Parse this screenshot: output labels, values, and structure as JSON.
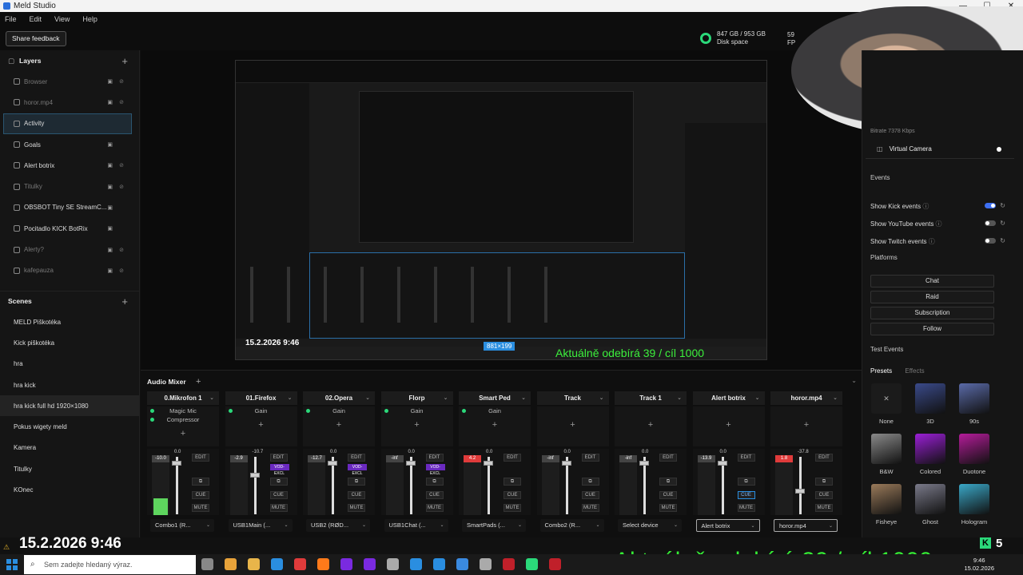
{
  "window": {
    "title": "Meld Studio",
    "controls": [
      "—",
      "☐",
      "✕"
    ]
  },
  "menu": [
    "File",
    "Edit",
    "View",
    "Help"
  ],
  "toolbar": {
    "share_feedback": "Share feedback",
    "disk_usage": "847 GB / 953 GB",
    "disk_label": "Disk space",
    "fps_value": "59",
    "fps_label": "FP"
  },
  "layers": {
    "title": "Layers",
    "items": [
      {
        "label": "Browser",
        "dim": true,
        "locked": true,
        "hidden": true
      },
      {
        "label": "horor.mp4",
        "dim": true,
        "locked": true,
        "hidden": true
      },
      {
        "label": "Activity",
        "active": true
      },
      {
        "label": "Goals",
        "locked": true
      },
      {
        "label": "Alert botrix",
        "locked": true,
        "hidden": true
      },
      {
        "label": "Titulky",
        "dim": true,
        "locked": true,
        "hidden": true
      },
      {
        "label": "OBSBOT Tiny SE StreamC...",
        "locked": true
      },
      {
        "label": "Pocitadlo KICK BotRix",
        "locked": true
      },
      {
        "label": "Alerty?",
        "dim": true,
        "locked": true,
        "hidden": true
      },
      {
        "label": "kafepauza",
        "dim": true,
        "locked": true,
        "hidden": true
      }
    ]
  },
  "scenes": {
    "title": "Scenes",
    "items": [
      "MELD Piškotéka",
      "Kick piškotéka",
      "hra",
      "hra kick",
      "hra kick full hd 1920×1080",
      "Pokus wigety meld",
      "Kamera",
      "Titulky",
      "KOnec"
    ],
    "selected_index": 4
  },
  "preview": {
    "date_overlay": "15.2.2026 9:46",
    "subtitle_overlay": "Aktuálně odebírá 39 / cíl 1000",
    "selection_size": "881×199"
  },
  "right_panel": {
    "bitrate": "Bitrate  7378 Kbps",
    "virtual_camera": "Virtual Camera",
    "events_title": "Events",
    "events": [
      {
        "label": "Show Kick events",
        "on": true
      },
      {
        "label": "Show YouTube events",
        "on": false
      },
      {
        "label": "Show Twitch events",
        "on": false
      }
    ],
    "platforms_title": "Platforms",
    "platform_buttons": [
      "Chat",
      "Raid",
      "Subscription",
      "Follow"
    ],
    "test_events_title": "Test Events",
    "tabs": [
      "Presets",
      "Effects"
    ],
    "presets": [
      {
        "label": "None",
        "color": "#1b1b1b"
      },
      {
        "label": "3D",
        "color": "#3a4a8a"
      },
      {
        "label": "90s",
        "color": "#5a6aa8"
      },
      {
        "label": "B&W",
        "color": "#8a8a8a"
      },
      {
        "label": "Colored",
        "color": "#9b1fd6"
      },
      {
        "label": "Duotone",
        "color": "#b51c9a"
      },
      {
        "label": "Fisheye",
        "color": "#9a7a5a"
      },
      {
        "label": "Ghost",
        "color": "#7a7a8a"
      },
      {
        "label": "Hologram",
        "color": "#3aa8c8"
      }
    ]
  },
  "mixer": {
    "title": "Audio Mixer",
    "channels": [
      {
        "name": "0.Mikrofon 1",
        "fx": [
          "Magic Mic",
          "Compressor"
        ],
        "level": "-10.0",
        "peak": "0.0",
        "meter_fill": 0.28,
        "fader": 0.08,
        "vod": false,
        "cue_on": false,
        "device": "Combo1 (R...",
        "highlight": false,
        "red": false
      },
      {
        "name": "01.Firefox",
        "fx": [
          "Gain"
        ],
        "level": "-2.9",
        "peak": "-10.7",
        "meter_fill": 0.0,
        "fader": 0.3,
        "vod": true,
        "cue_on": false,
        "device": "USB1Main (...",
        "highlight": false,
        "red": false
      },
      {
        "name": "02.Opera",
        "fx": [
          "Gain"
        ],
        "level": "-12.7",
        "peak": "0.0",
        "meter_fill": 0.0,
        "fader": 0.08,
        "vod": true,
        "cue_on": false,
        "device": "USB2 (RØD...",
        "highlight": false,
        "red": false
      },
      {
        "name": "Florp",
        "fx": [
          "Gain"
        ],
        "level": "-inf",
        "peak": "0.0",
        "meter_fill": 0.0,
        "fader": 0.08,
        "vod": true,
        "cue_on": false,
        "device": "USB1Chat (...",
        "highlight": false,
        "red": false
      },
      {
        "name": "Smart Ped",
        "fx": [
          "Gain"
        ],
        "level": "4.2",
        "peak": "0.0",
        "meter_fill": 0.0,
        "fader": 0.08,
        "vod": false,
        "cue_on": false,
        "device": "SmartPads (...",
        "highlight": false,
        "red": true
      },
      {
        "name": "Track",
        "fx": [],
        "level": "-inf",
        "peak": "0.0",
        "meter_fill": 0.0,
        "fader": 0.08,
        "vod": false,
        "cue_on": false,
        "device": "Combo2 (R...",
        "highlight": false,
        "red": false
      },
      {
        "name": "Track 1",
        "fx": [],
        "level": "-inf",
        "peak": "0.0",
        "meter_fill": 0.0,
        "fader": 0.08,
        "vod": false,
        "cue_on": false,
        "device": "Select device",
        "highlight": false,
        "red": false
      },
      {
        "name": "Alert botrix",
        "fx": [],
        "level": "-13.9",
        "peak": "0.0",
        "meter_fill": 0.0,
        "fader": 0.08,
        "vod": false,
        "cue_on": true,
        "device": "Alert botrix",
        "highlight": true,
        "red": false
      },
      {
        "name": "horor.mp4",
        "fx": [],
        "level": "1.8",
        "peak": "-37.8",
        "meter_fill": 0.0,
        "fader": 0.6,
        "vod": false,
        "cue_on": false,
        "device": "horor.mp4",
        "highlight": true,
        "red": true
      }
    ],
    "labels": {
      "edit": "EDIT",
      "cue": "CUE",
      "mute": "MUTE",
      "vod": "VOD-EXCL"
    }
  },
  "overlay": {
    "date": "15.2.2026 9:46",
    "subtitle": "Aktuálně odebírá 39 / cíl 1000",
    "k_count": "5",
    "k_letter": "K"
  },
  "taskbar": {
    "search_placeholder": "Sem zadejte hledaný výraz.",
    "time": "9:46",
    "date": "15.02.2026",
    "icon_colors": [
      "#888",
      "#e8a33a",
      "#e8b54a",
      "#2a8ee0",
      "#e03b3b",
      "#ff7a1a",
      "#7a2ae0",
      "#7a2ae0",
      "#aaa",
      "#2a8ee0",
      "#2a8ee0",
      "#3a8ae0",
      "#aaa",
      "#c0202a",
      "#2bd97a",
      "#c0202a"
    ]
  }
}
